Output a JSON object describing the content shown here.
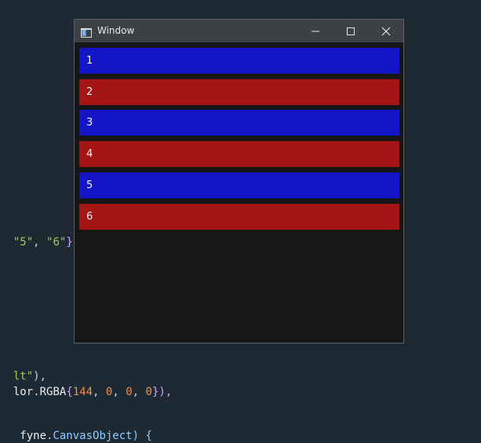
{
  "code": {
    "line1": {
      "s1": "\"5\"",
      "sep": ", ",
      "s2": "\"6\"",
      "close": "}"
    },
    "line2": {
      "s1": "lt\"",
      "close": "),"
    },
    "line3": {
      "ident": "lor",
      "dot": ".",
      "type": "RGBA",
      "open": "{",
      "n1": "144",
      "c1": ", ",
      "n2": "0",
      "c2": ", ",
      "n3": "0",
      "c3": ", ",
      "n4": "0",
      "close": "}),"
    },
    "line4": {
      "text": " fyne",
      "dot": ".",
      "type": "CanvasObject",
      "close": ") {"
    }
  },
  "window": {
    "title": "Window",
    "controls": [
      "minimize-icon",
      "maximize-icon",
      "close-icon"
    ]
  },
  "rows": [
    {
      "label": "1",
      "color": "#1515c8"
    },
    {
      "label": "2",
      "color": "#a51515"
    },
    {
      "label": "3",
      "color": "#1515c8"
    },
    {
      "label": "4",
      "color": "#a51515"
    },
    {
      "label": "5",
      "color": "#1515c8"
    },
    {
      "label": "6",
      "color": "#a51515"
    }
  ]
}
